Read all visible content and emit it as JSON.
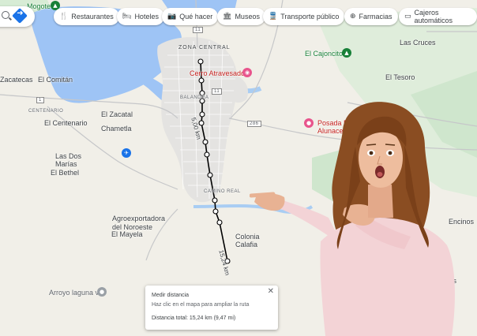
{
  "topbar": {
    "chips": [
      {
        "label": "Restaurantes",
        "icon": "restaurant-icon",
        "glyph": "🍴"
      },
      {
        "label": "Hoteles",
        "icon": "hotel-icon",
        "glyph": "🛏"
      },
      {
        "label": "Qué hacer",
        "icon": "camera-icon",
        "glyph": "📷"
      },
      {
        "label": "Museos",
        "icon": "museum-icon",
        "glyph": "🏛"
      },
      {
        "label": "Transporte público",
        "icon": "transit-icon",
        "glyph": "🚆"
      },
      {
        "label": "Farmacias",
        "icon": "pharmacy-icon",
        "glyph": "⊕"
      },
      {
        "label": "Cajeros automáticos",
        "icon": "atm-icon",
        "glyph": "▭"
      }
    ]
  },
  "map": {
    "places": {
      "zacatecas": "Zacatecas",
      "el_comitan": "El Comitán",
      "el_centenario": "El Centenario",
      "centenario_small": "CENTENARIO",
      "el_zacatal": "El Zacatal",
      "chametla": "Chametla",
      "las_dos_marias": "Las Dos\nMarías",
      "el_bethel": "El Bethel",
      "agroexportadora": "Agroexportadora\ndel Noroeste",
      "el_mayela": "El Mayela",
      "arroyo_laguna": "Arroyo laguna v",
      "zona_central": "ZONA CENTRAL",
      "balandra": "BALANDRA",
      "camino_real": "CAMINO REAL",
      "colonia_calafia": "Colonia\nCalafia",
      "las_cruces": "Las Cruces",
      "el_cajoncito": "El Cajoncito",
      "el_tesoro": "El Tesoro",
      "el_mogote": "Mogote",
      "encinos": "Encinos",
      "ritos": "tos",
      "cerro_atravesado": "Cerro Atravesado",
      "posada": "Posada Eco\nAlunacer"
    },
    "highways": [
      "11",
      "1",
      "286",
      "1",
      "286",
      "11"
    ],
    "segment_distance": "5,00 km",
    "total_label": "15,24 km"
  },
  "panel": {
    "title": "Medir distancia",
    "hint": "Haz clic en el mapa para ampliar la ruta",
    "total": "Distancia total: 15,24 km (9,47 mi)"
  }
}
